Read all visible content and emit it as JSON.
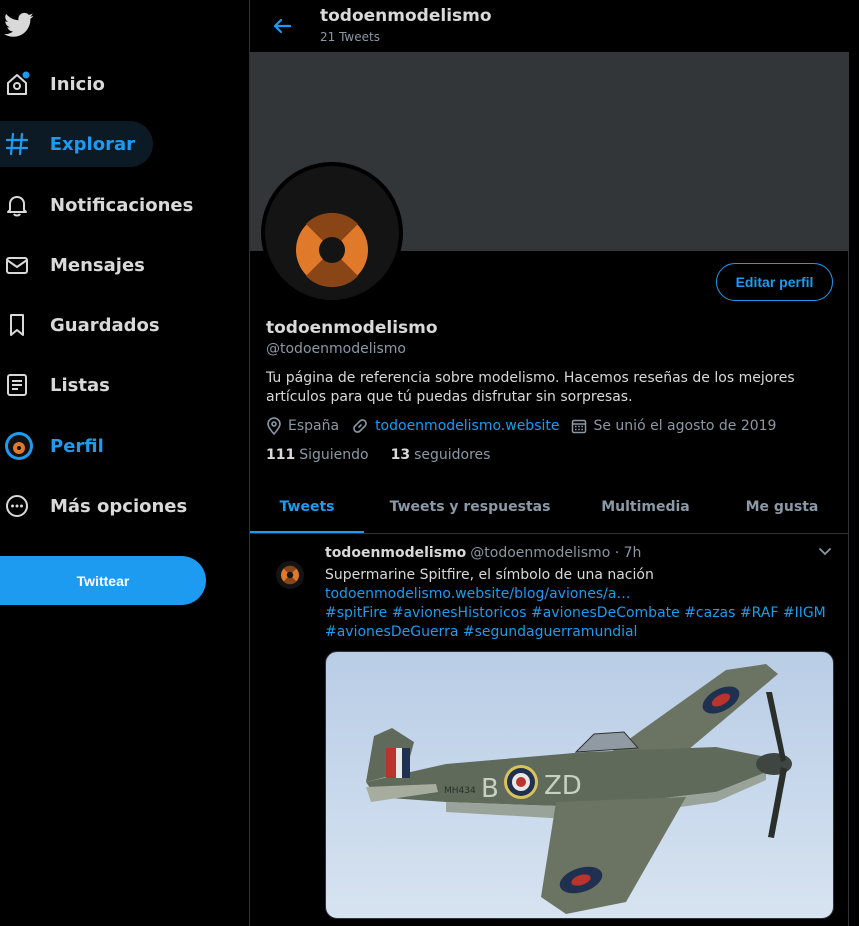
{
  "sidebar": {
    "logo_icon": "twitter-bird-icon",
    "items": [
      {
        "label": "Inicio",
        "icon": "home-icon"
      },
      {
        "label": "Explorar",
        "icon": "hashtag-icon"
      },
      {
        "label": "Notificaciones",
        "icon": "bell-icon"
      },
      {
        "label": "Mensajes",
        "icon": "envelope-icon"
      },
      {
        "label": "Guardados",
        "icon": "bookmark-icon"
      },
      {
        "label": "Listas",
        "icon": "list-icon"
      },
      {
        "label": "Perfil",
        "icon": "profile-avatar-icon"
      },
      {
        "label": "Más opciones",
        "icon": "more-icon"
      }
    ],
    "tweet_button": "Twittear"
  },
  "header": {
    "name": "todoenmodelismo",
    "tweet_count": "21 Tweets"
  },
  "profile": {
    "edit_button": "Editar perfil",
    "name": "todoenmodelismo",
    "handle": "@todoenmodelismo",
    "bio": "Tu página de referencia sobre modelismo. Hacemos reseñas de los mejores artículos para que tú puedas disfrutar sin sorpresas.",
    "location": "España",
    "website": "todoenmodelismo.website",
    "joined": "Se unió el agosto de 2019",
    "following_count": "111",
    "following_label": "Siguiendo",
    "followers_count": "13",
    "followers_label": "seguidores"
  },
  "tabs": [
    {
      "label": "Tweets"
    },
    {
      "label": "Tweets y respuestas"
    },
    {
      "label": "Multimedia"
    },
    {
      "label": "Me gusta"
    }
  ],
  "tweet": {
    "name": "todoenmodelismo",
    "handle_time": "@todoenmodelismo · 7h",
    "text": "Supermarine Spitfire, el símbolo de una nación",
    "link": "todoenmodelismo.website/blog/aviones/a…",
    "hashtags": "#spitFire #avionesHistoricos #avionesDeCombate #cazas #RAF #IIGM #avionesDeGuerra #segundaguerramundial",
    "image_text": "B ZD",
    "image_serial": "MH434"
  },
  "colors": {
    "accent": "#1d9bf0",
    "background": "#000000",
    "text": "#d9d9d9",
    "muted": "#8b98a5"
  }
}
